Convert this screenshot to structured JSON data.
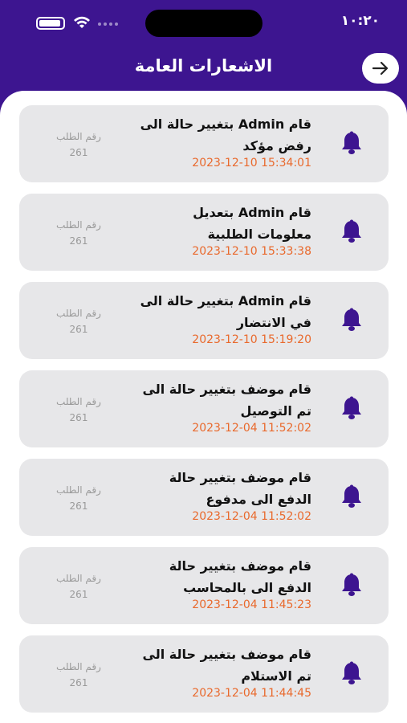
{
  "status_bar": {
    "time": "١٠:٢٠",
    "icons": [
      "battery-icon",
      "wifi-icon",
      "signal-icon"
    ]
  },
  "header": {
    "title": "الاشعارات العامة",
    "back_icon": "arrow-right-icon"
  },
  "colors": {
    "brand": "#3d1590",
    "date": "#e9692c",
    "card": "#e7e7e9"
  },
  "notifications": [
    {
      "line1": "قام Admin بتغيير حالة الى",
      "line2": "رفض مؤكد",
      "date": "2023-12-10 15:34:01",
      "order_label": "رقم الطلب",
      "order_number": "261"
    },
    {
      "line1": "قام Admin بتعديل",
      "line2": "معلومات الطلبية",
      "date": "2023-12-10 15:33:38",
      "order_label": "رقم الطلب",
      "order_number": "261"
    },
    {
      "line1": "قام Admin بتغيير حالة الى",
      "line2": "في الانتضار",
      "date": "2023-12-10 15:19:20",
      "order_label": "رقم الطلب",
      "order_number": "261"
    },
    {
      "line1": "قام موضف بتغيير حالة الى",
      "line2": "تم التوصيل",
      "date": "2023-12-04 11:52:02",
      "order_label": "رقم الطلب",
      "order_number": "261"
    },
    {
      "line1": "قام موضف بتغيير حالة",
      "line2": "الدفع الى مدفوع",
      "date": "2023-12-04 11:52:02",
      "order_label": "رقم الطلب",
      "order_number": "261"
    },
    {
      "line1": "قام موضف بتغيير حالة",
      "line2": "الدفع الى بالمحاسب",
      "date": "2023-12-04 11:45:23",
      "order_label": "رقم الطلب",
      "order_number": "261"
    },
    {
      "line1": "قام موضف بتغيير حالة الى",
      "line2": "تم الاستلام",
      "date": "2023-12-04 11:44:45",
      "order_label": "رقم الطلب",
      "order_number": "261"
    }
  ]
}
